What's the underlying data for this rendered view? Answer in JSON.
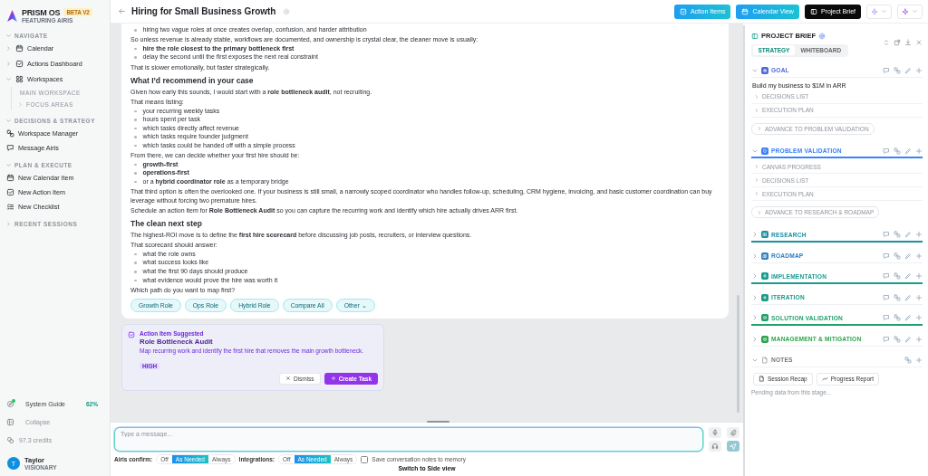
{
  "sidebar": {
    "brand": "PRISM OS",
    "badge": "BETA V2",
    "tagline": "FEATURING AIRIS",
    "sections": [
      {
        "label": "NAVIGATE",
        "expanded": true,
        "items": [
          {
            "label": "Calendar",
            "expanded": false
          },
          {
            "label": "Actions Dashboard",
            "expanded": false
          },
          {
            "label": "Workspaces",
            "expanded": true,
            "children": [
              {
                "label": "MAIN WORKSPACE"
              },
              {
                "label": "FOCUS AREAS",
                "expanded": false
              }
            ]
          }
        ]
      },
      {
        "label": "DECISIONS & STRATEGY",
        "expanded": true,
        "items": [
          {
            "label": "Workspace Manager"
          },
          {
            "label": "Message Airis"
          }
        ]
      },
      {
        "label": "PLAN & EXECUTE",
        "expanded": true,
        "items": [
          {
            "label": "New Calendar Item"
          },
          {
            "label": "New Action Item"
          },
          {
            "label": "New Checklist"
          }
        ]
      },
      {
        "label": "RECENT SESSIONS",
        "expanded": false
      }
    ],
    "guide": {
      "label": "System Guide",
      "progress": "62%"
    },
    "collapse": "Collapse",
    "credits": "97.3 credits",
    "user": {
      "initial": "T",
      "name": "Taylor",
      "role": "VISIONARY"
    }
  },
  "header": {
    "title": "Hiring for Small Business Growth",
    "buttons": [
      {
        "label": "Action Items",
        "selected": false
      },
      {
        "label": "Calendar View",
        "selected": false
      },
      {
        "label": "Project Brief",
        "selected": true
      }
    ]
  },
  "chat": {
    "blocks": [
      {
        "kind": "bullet",
        "text": "hiring two vague roles at once creates overlap, confusion, and harder attribution"
      },
      {
        "kind": "para",
        "text": "So unless revenue is already stable, workflows are documented, and ownership is crystal clear, the cleaner move is usually:"
      },
      {
        "kind": "bullet",
        "text": "hire the role closest to the primary bottleneck first",
        "bold": true
      },
      {
        "kind": "bullet",
        "text": "delay the second until the first exposes the next real constraint"
      },
      {
        "kind": "para",
        "text": "That is slower emotionally, but faster strategically."
      },
      {
        "kind": "heading",
        "text": "What I’d recommend in your case"
      },
      {
        "kind": "para",
        "text": "Given how early this sounds, I would start with a **role bottleneck audit**, not recruiting."
      },
      {
        "kind": "para",
        "text": "That means listing:"
      },
      {
        "kind": "bullet",
        "text": "your recurring weekly tasks"
      },
      {
        "kind": "bullet",
        "text": "hours spent per task"
      },
      {
        "kind": "bullet",
        "text": "which tasks directly affect revenue"
      },
      {
        "kind": "bullet",
        "text": "which tasks require founder judgment"
      },
      {
        "kind": "bullet",
        "text": "which tasks could be handed off with a simple process"
      },
      {
        "kind": "para",
        "text": "From there, we can decide whether your first hire should be:"
      },
      {
        "kind": "bullet",
        "text": "growth-first",
        "bold": true
      },
      {
        "kind": "bullet",
        "text": "operations-first",
        "bold": true
      },
      {
        "kind": "bullet",
        "text": "or a **hybrid coordinator role** as a temporary bridge"
      },
      {
        "kind": "para",
        "text": "That third option is often the overlooked one. If your business is still small, a narrowly scoped coordinator who handles follow-up, scheduling, CRM hygiene, invoicing, and basic customer coordination can buy leverage without forcing two premature hires."
      },
      {
        "kind": "para",
        "text": "Schedule an action item for **Role Bottleneck Audit** so you can capture the recurring work and identify which hire actually drives ARR first."
      },
      {
        "kind": "heading",
        "text": "The clean next step"
      },
      {
        "kind": "para",
        "text": "The highest-ROI move is to define the **first hire scorecard** before discussing job posts, recruiters, or interview questions."
      },
      {
        "kind": "para",
        "text": "That scorecard should answer:"
      },
      {
        "kind": "bullet",
        "text": "what the role owns"
      },
      {
        "kind": "bullet",
        "text": "what success looks like"
      },
      {
        "kind": "bullet",
        "text": "what the first 90 days should produce"
      },
      {
        "kind": "bullet",
        "text": "what evidence would prove the hire was worth it"
      },
      {
        "kind": "para",
        "text": "Which path do you want to map first?"
      }
    ],
    "chips": [
      "Growth Role",
      "Ops Role",
      "Hybrid Role",
      "Compare All",
      "Other ⌄"
    ],
    "suggestion": {
      "label": "Action Item Suggested",
      "title": "Role Bottleneck Audit",
      "description": "Map recurring work and identify the first hire that removes the main growth bottleneck.",
      "priority": "HIGH",
      "dismiss": "Dismiss",
      "create": "Create Task"
    }
  },
  "composer": {
    "placeholder": "Type a message...",
    "toggles": [
      {
        "label": "Airis confirm:",
        "options": [
          {
            "label": "Off",
            "selected": false
          },
          {
            "label": "As Needed",
            "selected": true
          },
          {
            "label": "Always",
            "selected": false
          }
        ]
      },
      {
        "label": "Integrations:",
        "options": [
          {
            "label": "Off",
            "selected": false
          },
          {
            "label": "As Needed",
            "selected": true
          },
          {
            "label": "Always",
            "selected": false
          }
        ]
      }
    ],
    "memory": {
      "label": "Save conversation notes to memory",
      "checked": false
    },
    "switch_link": "Switch to Side view"
  },
  "brief": {
    "title": "PROJECT BRIEF",
    "tabs": [
      {
        "label": "STRATEGY",
        "selected": true
      },
      {
        "label": "WHITEBOARD",
        "selected": false
      }
    ],
    "sections": [
      {
        "label": "GOAL",
        "color": "#4f6bd8",
        "expanded": true,
        "highlighted": false,
        "summary": "Build my business to $1M in ARR",
        "items": [
          "DECISIONS LIST",
          "EXECUTION PLAN"
        ],
        "advance": "ADVANCE TO PROBLEM VALIDATION"
      },
      {
        "label": "PROBLEM VALIDATION",
        "color": "#3b82f6",
        "expanded": true,
        "highlighted": true,
        "items": [
          "CANVAS PROGRESS",
          "DECISIONS LIST",
          "EXECUTION PLAN"
        ],
        "advance": "ADVANCE TO RESEARCH & ROADMAP"
      },
      {
        "label": "RESEARCH",
        "color": "#1c8fa3",
        "expanded": false,
        "highlighted": true
      },
      {
        "label": "ROADMAP",
        "color": "#2a7fc4",
        "expanded": false,
        "highlighted": false
      },
      {
        "label": "IMPLEMENTATION",
        "color": "#169c8e",
        "expanded": false,
        "highlighted": true
      },
      {
        "label": "ITERATION",
        "color": "#1a9a86",
        "expanded": false,
        "highlighted": false
      },
      {
        "label": "SOLUTION VALIDATION",
        "color": "#22a06b",
        "expanded": false,
        "highlighted": true
      },
      {
        "label": "MANAGEMENT & MITIGATION",
        "color": "#2ea44f",
        "expanded": false,
        "highlighted": false
      }
    ],
    "notes": {
      "label": "NOTES",
      "expanded": true,
      "buttons": [
        "Session Recap",
        "Progress Report"
      ],
      "pending": "Pending data from this stage..."
    }
  }
}
